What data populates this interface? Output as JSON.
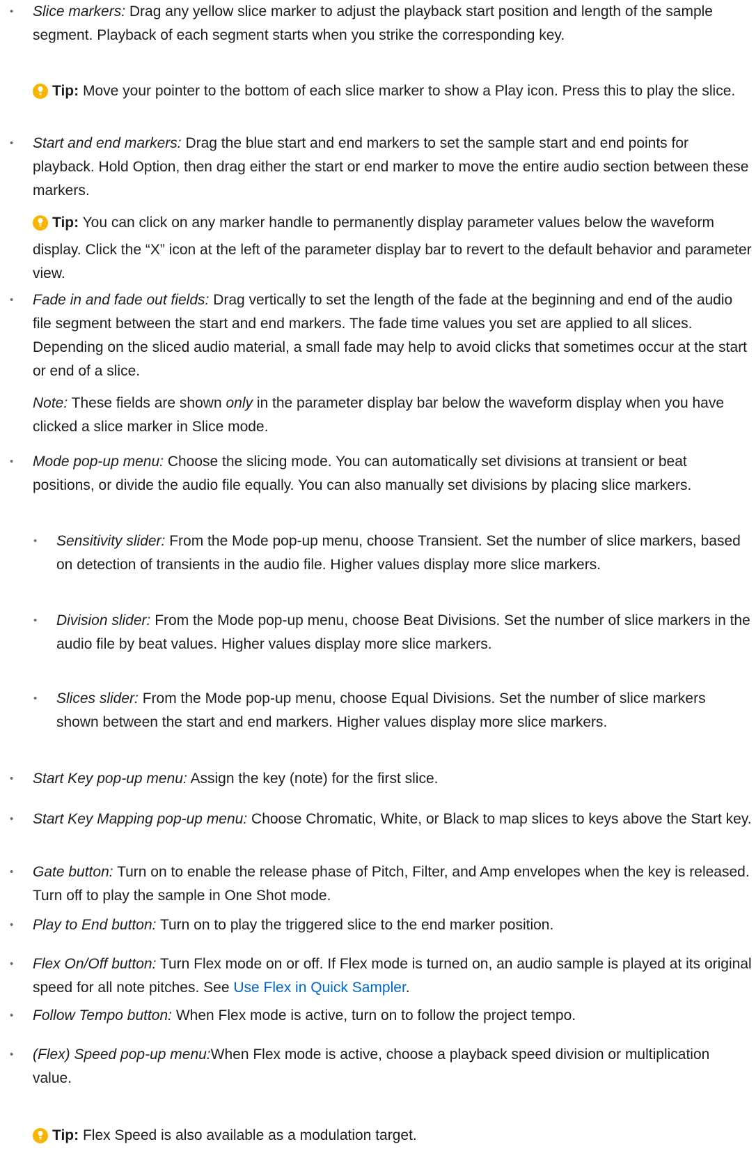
{
  "items": [
    {
      "label": "Slice markers:",
      "text": "Drag any yellow slice marker to adjust the playback start position and length of the sample segment. Playback of each segment starts when you strike the corresponding key."
    },
    {
      "tip_label": "Tip:",
      "text": "Move your pointer to the bottom of each slice marker to show a Play icon. Press this to play the slice."
    },
    {
      "label": "Start and end markers:",
      "text": "Drag the blue start and end markers to set the sample start and end points for playback. Hold Option, then drag either the start or end marker to move the entire audio section between these markers."
    },
    {
      "tip_label": "Tip:",
      "text": "You can click on any marker handle to permanently display parameter values below the waveform display. Click the “X” icon at the left of the parameter display bar to revert to the default behavior and parameter view."
    },
    {
      "label": "Fade in and fade out fields:",
      "text": "Drag vertically to set the length of the fade at the beginning and end of the audio file segment between the start and end markers. The fade time values you set are applied to all slices. Depending on the sliced audio material, a small fade may help to avoid clicks that sometimes occur at the start or end of a slice."
    },
    {
      "note_label": "Note:",
      "text_a": "These fields are shown",
      "em": "only",
      "text_b": "in the parameter display bar below the waveform display when you have clicked a slice marker in Slice mode."
    },
    {
      "label": "Mode pop-up menu:",
      "text": "Choose the slicing mode. You can automatically set divisions at transient or beat positions, or divide the audio file equally. You can also manually set divisions by placing slice markers."
    },
    {
      "label": "Sensitivity slider:",
      "text": "From the Mode pop-up menu, choose Transient. Set the number of slice markers, based on detection of transients in the audio file. Higher values display more slice markers."
    },
    {
      "label": "Division slider:",
      "text": "From the Mode pop-up menu, choose Beat Divisions. Set the number of slice markers in the audio file by beat values. Higher values display more slice markers."
    },
    {
      "label": "Slices slider:",
      "text": "From the Mode pop-up menu, choose Equal Divisions. Set the number of slice markers shown between the start and end markers. Higher values display more slice markers."
    },
    {
      "label": "Start Key pop-up menu:",
      "text": "Assign the key (note) for the first slice."
    },
    {
      "label": "Start Key Mapping pop-up menu:",
      "text": "Choose Chromatic, White, or Black to map slices to keys above the Start key."
    },
    {
      "label": "Gate button:",
      "text": "Turn on to enable the release phase of Pitch, Filter, and Amp envelopes when the key is released. Turn off to play the sample in One Shot mode."
    },
    {
      "label": "Play to End button:",
      "text": "Turn on to play the triggered slice to the end marker position."
    },
    {
      "label": "Flex On/Off button:",
      "text": "Turn Flex mode on or off. If Flex mode is turned on, an audio sample is played at its original speed for all note pitches. See",
      "link": "Use Flex in Quick Sampler",
      "after": "."
    },
    {
      "label": "Follow Tempo button:",
      "text": "When Flex mode is active, turn on to follow the project tempo."
    },
    {
      "label": "(Flex) Speed pop-up menu:",
      "text": "When Flex mode is active, choose a playback speed division or multiplication value."
    },
    {
      "tip_label": "Tip:",
      "text": "Flex Speed is also available as a modulation target."
    }
  ],
  "bullet_glyph": "•",
  "colors": {
    "link": "#0066cc",
    "tip_icon": "#f7b500",
    "text": "#1d1d1f"
  }
}
